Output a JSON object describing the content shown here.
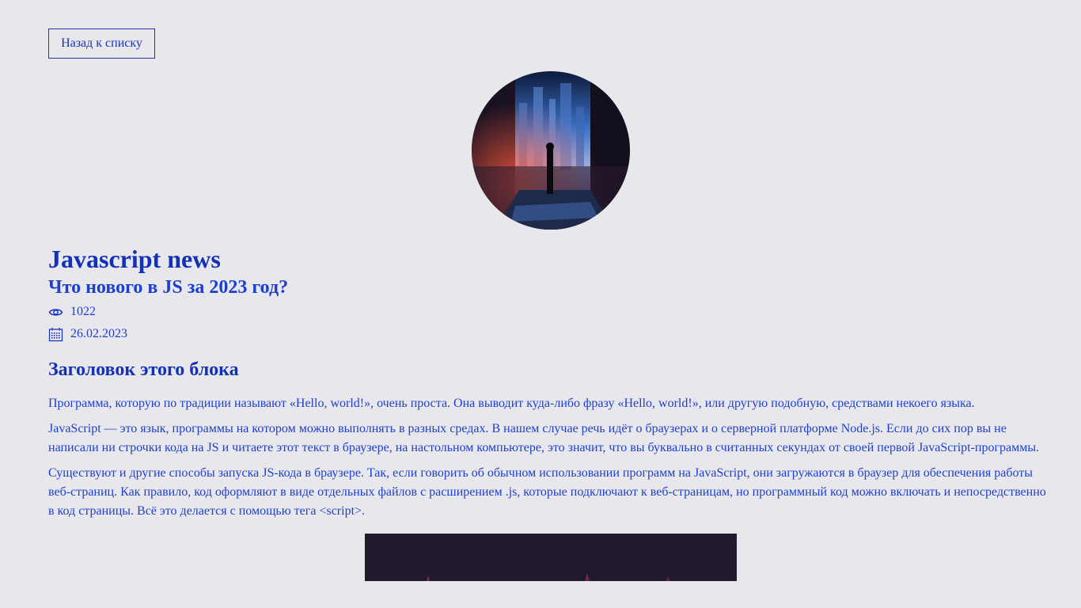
{
  "back_button": {
    "label": "Назад к списку"
  },
  "article": {
    "title": "Javascript news",
    "subtitle": "Что нового в JS за 2023 год?",
    "views": "1022",
    "date": "26.02.2023",
    "block_heading": "Заголовок этого блока",
    "paragraphs": [
      "Программа, которую по традиции называют «Hello, world!», очень проста. Она выводит куда-либо фразу «Hello, world!», или другую подобную, средствами некоего языка.",
      "JavaScript — это язык, программы на котором можно выполнять в разных средах. В нашем случае речь идёт о браузерах и о серверной платформе Node.js. Если до сих пор вы не написали ни строчки кода на JS и читаете этот текст в браузере, на настольном компьютере, это значит, что вы буквально в считанных секундах от своей первой JavaScript-программы.",
      "Существуют и другие способы запуска JS-кода в браузере. Так, если говорить об обычном использовании программ на JavaScript, они загружаются в браузер для обеспечения работы веб-страниц. Как правило, код оформляют в виде отдельных файлов с расширением .js, которые подключают к веб-страницам, но программный код можно включать и непосредственно в код страницы. Всё это делается с помощью тега <script>."
    ]
  },
  "icons": {
    "views": "eye-icon",
    "date": "calendar-icon"
  },
  "colors": {
    "background": "#e8e8ec",
    "text": "#1d3fcf",
    "heading": "#1330b8"
  }
}
